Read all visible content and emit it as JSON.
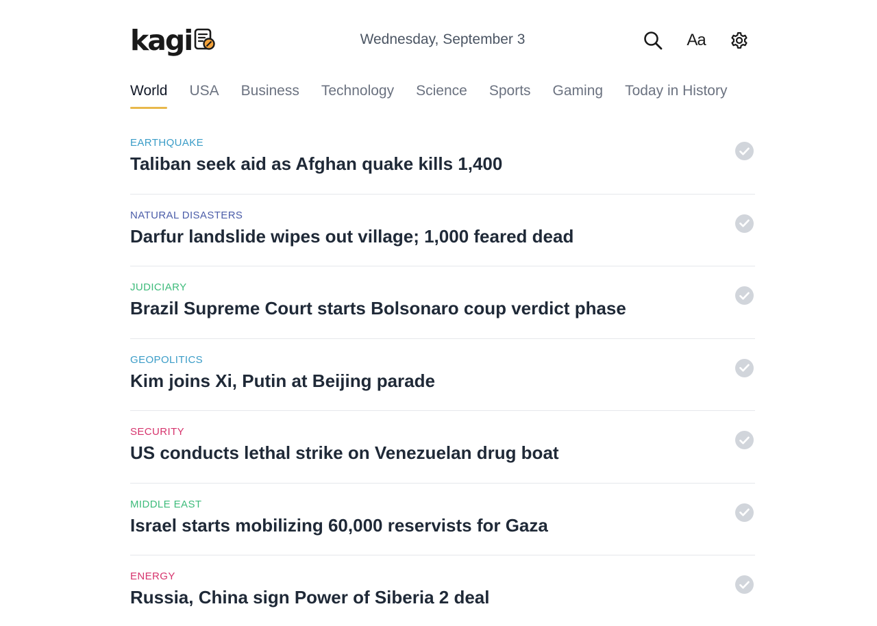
{
  "brand": {
    "name": "kagi"
  },
  "header": {
    "date": "Wednesday, September 3",
    "font_toggle_label": "Aa"
  },
  "tabs": [
    {
      "label": "World",
      "active": true
    },
    {
      "label": "USA",
      "active": false
    },
    {
      "label": "Business",
      "active": false
    },
    {
      "label": "Technology",
      "active": false
    },
    {
      "label": "Science",
      "active": false
    },
    {
      "label": "Sports",
      "active": false
    },
    {
      "label": "Gaming",
      "active": false
    },
    {
      "label": "Today in History",
      "active": false
    }
  ],
  "colors": {
    "tab_underline": "#e8b84b",
    "check_bg": "#d1d5db",
    "title": "#1f2937"
  },
  "stories": [
    {
      "category": "EARTHQUAKE",
      "category_color": "#3a9cc7",
      "title": "Taliban seek aid as Afghan quake kills 1,400"
    },
    {
      "category": "NATURAL DISASTERS",
      "category_color": "#4a5ca8",
      "title": "Darfur landslide wipes out village; 1,000 feared dead"
    },
    {
      "category": "JUDICIARY",
      "category_color": "#3dbb7a",
      "title": "Brazil Supreme Court starts Bolsonaro coup verdict phase"
    },
    {
      "category": "GEOPOLITICS",
      "category_color": "#3a9cc7",
      "title": "Kim joins Xi, Putin at Beijing parade"
    },
    {
      "category": "SECURITY",
      "category_color": "#d6336c",
      "title": "US conducts lethal strike on Venezuelan drug boat"
    },
    {
      "category": "MIDDLE EAST",
      "category_color": "#3dbb7a",
      "title": "Israel starts mobilizing 60,000 reservists for Gaza"
    },
    {
      "category": "ENERGY",
      "category_color": "#d6336c",
      "title": "Russia, China sign Power of Siberia 2 deal"
    }
  ],
  "icons": {
    "logo": "newspaper-icon",
    "search": "search-icon",
    "settings": "gear-icon",
    "read": "check-circle-icon"
  }
}
